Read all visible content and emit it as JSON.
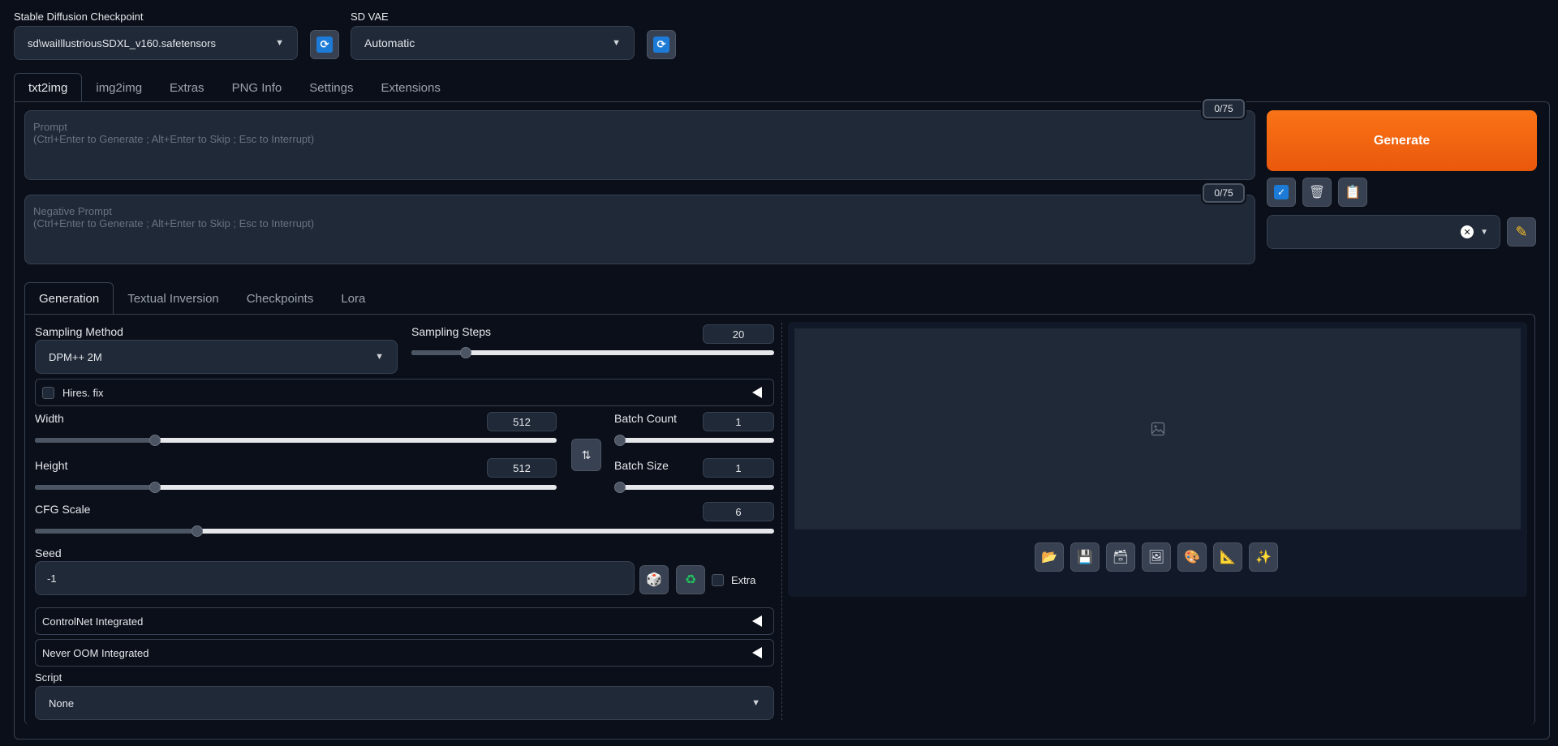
{
  "header": {
    "checkpoint_label": "Stable Diffusion Checkpoint",
    "checkpoint_value": "sd\\waiIllustriousSDXL_v160.safetensors",
    "vae_label": "SD VAE",
    "vae_value": "Automatic"
  },
  "main_tabs": [
    "txt2img",
    "img2img",
    "Extras",
    "PNG Info",
    "Settings",
    "Extensions"
  ],
  "prompt": {
    "placeholder_title": "Prompt",
    "placeholder_hint": "(Ctrl+Enter to Generate ; Alt+Enter to Skip ; Esc to Interrupt)",
    "counter": "0/75"
  },
  "negative_prompt": {
    "placeholder_title": "Negative Prompt",
    "placeholder_hint": "(Ctrl+Enter to Generate ; Alt+Enter to Skip ; Esc to Interrupt)",
    "counter": "0/75"
  },
  "generate_label": "Generate",
  "sub_tabs": [
    "Generation",
    "Textual Inversion",
    "Checkpoints",
    "Lora"
  ],
  "params": {
    "sampling_method_label": "Sampling Method",
    "sampling_method_value": "DPM++ 2M",
    "sampling_steps_label": "Sampling Steps",
    "sampling_steps_value": "20",
    "sampling_steps_fraction": 0.15,
    "hires_label": "Hires. fix",
    "width_label": "Width",
    "width_value": "512",
    "width_fraction": 0.23,
    "height_label": "Height",
    "height_value": "512",
    "height_fraction": 0.23,
    "batch_count_label": "Batch Count",
    "batch_count_value": "1",
    "batch_count_fraction": 0.0,
    "batch_size_label": "Batch Size",
    "batch_size_value": "1",
    "batch_size_fraction": 0.0,
    "cfg_label": "CFG Scale",
    "cfg_value": "6",
    "cfg_fraction": 0.22,
    "seed_label": "Seed",
    "seed_value": "-1",
    "extra_label": "Extra",
    "controlnet_label": "ControlNet Integrated",
    "neveroom_label": "Never OOM Integrated",
    "script_label": "Script",
    "script_value": "None"
  },
  "colors": {
    "generate": "#f46a14",
    "background": "#0b0f19",
    "panel": "#1f2937"
  }
}
